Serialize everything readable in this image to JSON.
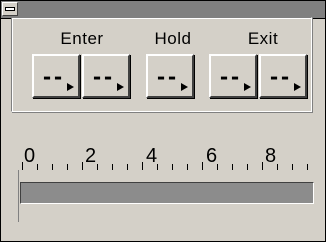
{
  "groups": [
    {
      "label": "Enter"
    },
    {
      "label": "Hold"
    },
    {
      "label": "Exit"
    }
  ],
  "buttons": [
    {
      "value": "--",
      "icon": "arrow-right-icon"
    },
    {
      "value": "--",
      "icon": "arrow-right-icon"
    },
    {
      "value": "--",
      "icon": "arrow-right-icon"
    },
    {
      "value": "--",
      "icon": "arrow-right-icon"
    },
    {
      "value": "--",
      "icon": "arrow-right-icon"
    }
  ],
  "scale": {
    "labels": [
      "0",
      "2",
      "4",
      "6",
      "8"
    ]
  },
  "progress": {
    "value": 1.0,
    "fill_color": "#8c8c8c"
  },
  "colors": {
    "face": "#d4d0c8",
    "titlebar": "#808080"
  }
}
